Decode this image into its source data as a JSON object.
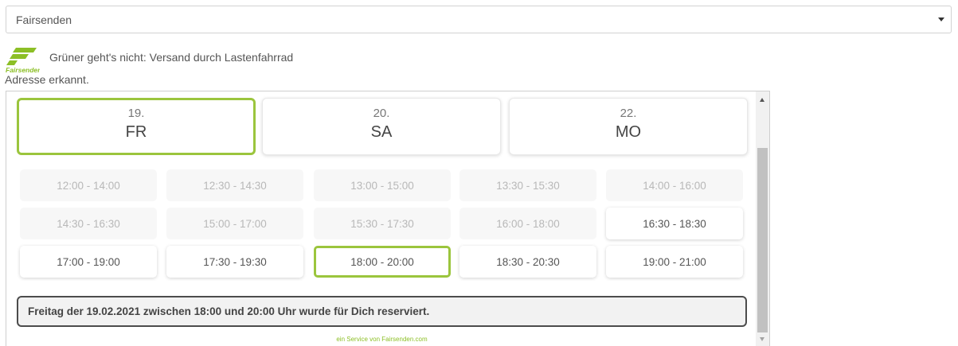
{
  "select": {
    "value": "Fairsenden",
    "icon": "caret-down-icon"
  },
  "logo": {
    "text": "Fairsenden",
    "color": "#8cbf26"
  },
  "tagline": "Grüner geht's nicht: Versand durch Lastenfahrrad",
  "address_status": "Adresse erkannt.",
  "accent_color": "#9bc53d",
  "days": [
    {
      "num": "19.",
      "weekday": "FR",
      "selected": true
    },
    {
      "num": "20.",
      "weekday": "SA",
      "selected": false
    },
    {
      "num": "22.",
      "weekday": "MO",
      "selected": false
    }
  ],
  "slots": [
    {
      "label": "12:00 - 14:00",
      "state": "disabled"
    },
    {
      "label": "12:30 - 14:30",
      "state": "disabled"
    },
    {
      "label": "13:00 - 15:00",
      "state": "disabled"
    },
    {
      "label": "13:30 - 15:30",
      "state": "disabled"
    },
    {
      "label": "14:00 - 16:00",
      "state": "disabled"
    },
    {
      "label": "14:30 - 16:30",
      "state": "disabled"
    },
    {
      "label": "15:00 - 17:00",
      "state": "disabled"
    },
    {
      "label": "15:30 - 17:30",
      "state": "disabled"
    },
    {
      "label": "16:00 - 18:00",
      "state": "disabled"
    },
    {
      "label": "16:30 - 18:30",
      "state": "available"
    },
    {
      "label": "17:00 - 19:00",
      "state": "available"
    },
    {
      "label": "17:30 - 19:30",
      "state": "available"
    },
    {
      "label": "18:00 - 20:00",
      "state": "selected"
    },
    {
      "label": "18:30 - 20:30",
      "state": "available"
    },
    {
      "label": "19:00 - 21:00",
      "state": "available"
    }
  ],
  "confirmation": "Freitag der 19.02.2021 zwischen 18:00 und 20:00 Uhr wurde für Dich reserviert.",
  "service_link": "ein Service von Fairsenden.com"
}
